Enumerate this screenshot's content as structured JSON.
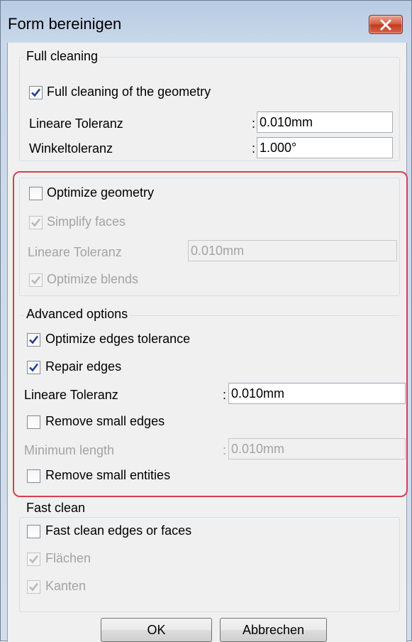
{
  "window": {
    "title": "Form bereinigen"
  },
  "full_cleaning": {
    "title": "Full cleaning",
    "full_cleaning_label": "Full cleaning of the geometry",
    "full_cleaning_checked": true,
    "lin_tol_label": "Lineare Toleranz",
    "lin_tol_value": "0.010mm",
    "angle_tol_label": "Winkeltoleranz",
    "angle_tol_value": "1.000°",
    "colon": ":"
  },
  "optimize": {
    "optimize_geometry_label": "Optimize geometry",
    "optimize_geometry_checked": false,
    "simplify_faces_label": "Simplify faces",
    "simplify_faces_checked": true,
    "lin_tol_label": "Lineare Toleranz",
    "lin_tol_value": "0.010mm",
    "optimize_blends_label": "Optimize blends",
    "optimize_blends_checked": true
  },
  "advanced": {
    "title": "Advanced options",
    "optimize_edges_label": "Optimize edges tolerance",
    "optimize_edges_checked": true,
    "repair_edges_label": "Repair edges",
    "repair_edges_checked": true,
    "lin_tol_label": "Lineare Toleranz",
    "lin_tol_value": "0.010mm",
    "remove_small_edges_label": "Remove small edges",
    "remove_small_edges_checked": false,
    "min_length_label": "Minimum length",
    "min_length_value": "0.010mm",
    "remove_small_entities_label": "Remove small entities",
    "remove_small_entities_checked": false
  },
  "fast_clean": {
    "title": "Fast clean",
    "fast_clean_label": "Fast clean edges or faces",
    "fast_clean_checked": false,
    "faces_label": "Flächen",
    "faces_checked": true,
    "edges_label": "Kanten",
    "edges_checked": true
  },
  "buttons": {
    "ok": "OK",
    "cancel": "Abbrechen"
  },
  "colors": {
    "highlight_frame": "#d6404f",
    "check": "#2a3f8f",
    "disabled_text": "#a3a3a3"
  },
  "icons": {
    "close": "close-icon",
    "check": "checkmark-icon"
  }
}
